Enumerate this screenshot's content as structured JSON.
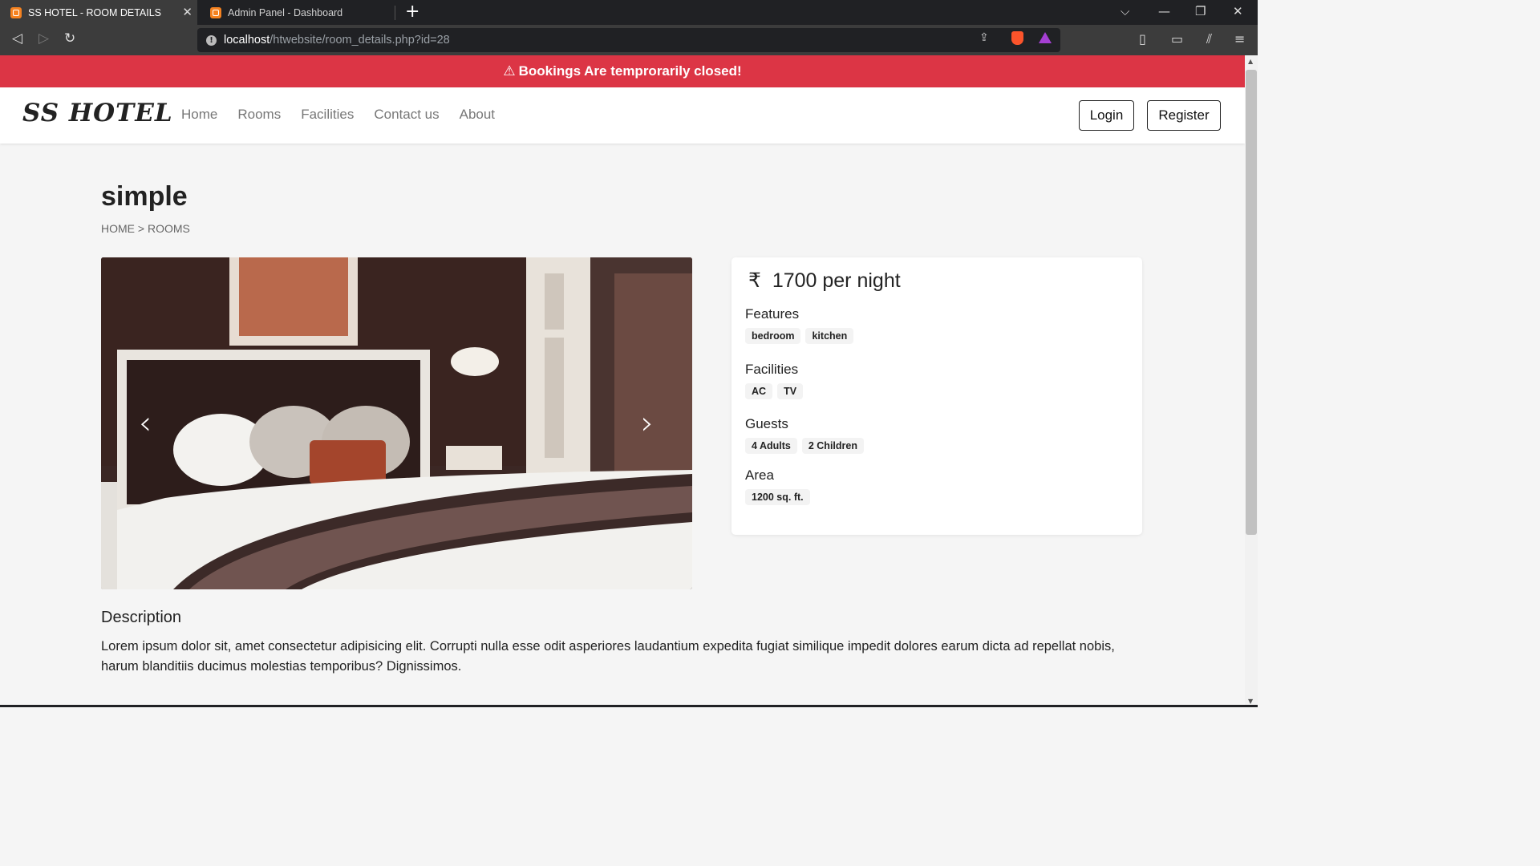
{
  "browser": {
    "tabs": [
      {
        "title": "SS HOTEL - ROOM DETAILS",
        "active": true
      },
      {
        "title": "Admin Panel - Dashboard",
        "active": false
      }
    ],
    "url_host": "localhost",
    "url_path": "/htwebsite/room_details.php?id=28"
  },
  "alert": {
    "text": "Bookings Are temprorarily closed!",
    "color": "#dc3545"
  },
  "nav": {
    "brand": "SS HOTEL",
    "links": [
      "Home",
      "Rooms",
      "Facilities",
      "Contact us",
      "About"
    ],
    "login": "Login",
    "register": "Register"
  },
  "room": {
    "title": "simple",
    "breadcrumb": {
      "home": "HOME",
      "sep": ">",
      "rooms": "ROOMS"
    },
    "price_symbol": "₹",
    "price_text": "1700 per night",
    "features_label": "Features",
    "features": [
      "bedroom",
      "kitchen"
    ],
    "facilities_label": "Facilities",
    "facilities": [
      "AC",
      "TV"
    ],
    "guests_label": "Guests",
    "guests": [
      "4 Adults",
      "2 Children"
    ],
    "area_label": "Area",
    "area": [
      "1200 sq. ft."
    ],
    "description_label": "Description",
    "description": "Lorem ipsum dolor sit, amet consectetur adipisicing elit. Corrupti nulla esse odit asperiores laudantium expedita fugiat similique impedit dolores earum dicta ad repellat nobis, harum blanditiis ducimus molestias temporibus? Dignissimos."
  }
}
